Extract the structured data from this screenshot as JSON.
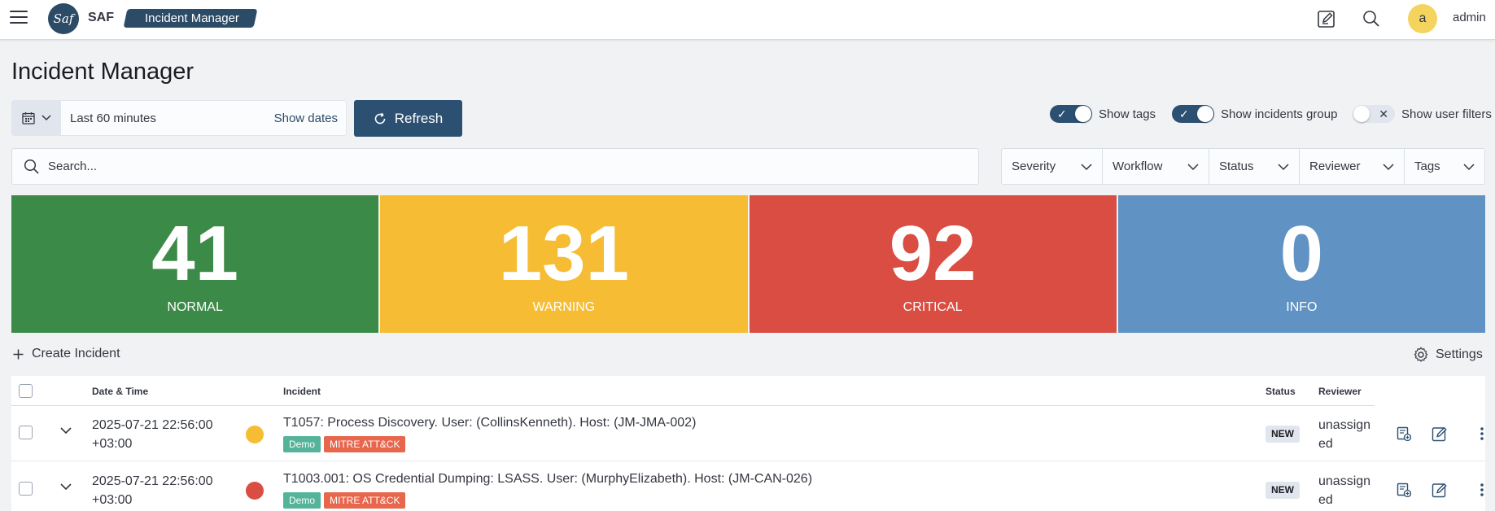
{
  "app": {
    "brand": "SAF",
    "logo_text": "Saf",
    "breadcrumb": "Incident Manager"
  },
  "user": {
    "initial": "a",
    "name": "admin"
  },
  "page": {
    "title": "Incident Manager"
  },
  "datepicker": {
    "range": "Last 60 minutes",
    "show_dates": "Show dates",
    "icon": "calendar-icon"
  },
  "refresh": {
    "label": "Refresh",
    "icon": "refresh-icon"
  },
  "toggles": [
    {
      "label": "Show tags",
      "on": true
    },
    {
      "label": "Show incidents group",
      "on": true
    },
    {
      "label": "Show user filters",
      "on": false
    }
  ],
  "search": {
    "placeholder": "Search...",
    "value": ""
  },
  "filters": [
    "Severity",
    "Workflow",
    "Status",
    "Reviewer",
    "Tags"
  ],
  "cards": [
    {
      "value": "41",
      "label": "NORMAL",
      "color": "#3b8a47"
    },
    {
      "value": "131",
      "label": "WARNING",
      "color": "#f6bd34"
    },
    {
      "value": "92",
      "label": "CRITICAL",
      "color": "#da4d42"
    },
    {
      "value": "0",
      "label": "INFO",
      "color": "#6093c3"
    }
  ],
  "actions": {
    "create": "Create Incident",
    "settings": "Settings"
  },
  "table": {
    "headers": {
      "datetime": "Date & Time",
      "incident": "Incident",
      "status": "Status",
      "reviewer": "Reviewer"
    },
    "rows": [
      {
        "date": "2025-07-21 22:56:00",
        "tz": "+03:00",
        "severity_color": "#f6bd34",
        "title": "T1057: Process Discovery. User: (CollinsKenneth). Host: (JM-JMA-002)",
        "tags": [
          {
            "label": "Demo",
            "color": "#54b399"
          },
          {
            "label": "MITRE ATT&CK",
            "color": "#e7664c"
          }
        ],
        "status": "NEW",
        "reviewer": "unassigned"
      },
      {
        "date": "2025-07-21 22:56:00",
        "tz": "+03:00",
        "severity_color": "#da4d42",
        "title": "T1003.001: OS Credential Dumping: LSASS. User: (MurphyElizabeth). Host: (JM-CAN-026)",
        "tags": [
          {
            "label": "Demo",
            "color": "#54b399"
          },
          {
            "label": "MITRE ATT&CK",
            "color": "#e7664c"
          }
        ],
        "status": "NEW",
        "reviewer": "unassigned"
      }
    ]
  }
}
